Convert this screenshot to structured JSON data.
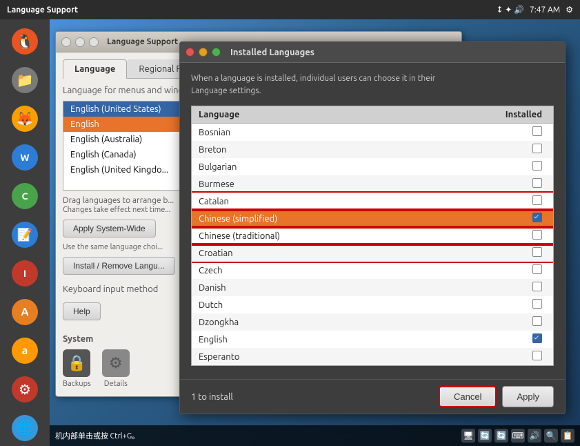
{
  "taskbar": {
    "title": "Language Support",
    "time": "7:47 AM",
    "icons": [
      "↕",
      "✦",
      "🔊"
    ]
  },
  "sidebar": {
    "items": [
      {
        "label": "Ubuntu",
        "color": "#e95420",
        "icon": "🐧"
      },
      {
        "label": "Files",
        "color": "#7a7a7a",
        "icon": "📁"
      },
      {
        "label": "Firefox",
        "color": "#f8a000",
        "icon": "🦊"
      },
      {
        "label": "Writer",
        "color": "#2d7dd6",
        "icon": "W"
      },
      {
        "label": "Calc",
        "color": "#48a34b",
        "icon": "C"
      },
      {
        "label": "Writer2",
        "color": "#2d7dd6",
        "icon": "📝"
      },
      {
        "label": "Impress",
        "color": "#c0392b",
        "icon": "I"
      },
      {
        "label": "Fonts",
        "color": "#e67e22",
        "icon": "A"
      },
      {
        "label": "Amazon",
        "color": "#ff9900",
        "icon": "a"
      },
      {
        "label": "Settings",
        "color": "#c0392b",
        "icon": "⚙"
      },
      {
        "label": "Network",
        "color": "#3498db",
        "icon": "🌐"
      }
    ]
  },
  "lang_support_window": {
    "title": "Language Support",
    "tabs": [
      "Language",
      "Regional Formats"
    ],
    "active_tab": "Language",
    "section_label": "Language for menus and windows:",
    "languages": [
      {
        "name": "English (United States)",
        "selected": true
      },
      {
        "name": "English",
        "selected": false
      },
      {
        "name": "English (Australia)",
        "selected": false
      },
      {
        "name": "English (Canada)",
        "selected": false
      },
      {
        "name": "English (United Kingdom)",
        "selected": false
      }
    ],
    "drag_note": "Drag languages to arrange b",
    "drag_note2": "Changes take effect next time",
    "apply_system_btn": "Apply System-Wide",
    "use_note": "Use the same language choi...",
    "install_btn": "Install / Remove Langu...",
    "keyboard_label": "Keyboard input method",
    "help_btn": "Help",
    "system_section": "System",
    "system_items": [
      {
        "label": "Backups",
        "icon": "🔒",
        "bg": "#555"
      },
      {
        "label": "Details",
        "icon": "⚙",
        "bg": "#888"
      }
    ]
  },
  "installed_dialog": {
    "title": "Installed Languages",
    "description": "When a language is installed, individual users can choose it in their\nLanguage settings.",
    "col_language": "Language",
    "col_installed": "Installed",
    "languages": [
      {
        "name": "Bosnian",
        "installed": false,
        "selected": false,
        "highlight": false
      },
      {
        "name": "Breton",
        "installed": false,
        "selected": false,
        "highlight": false
      },
      {
        "name": "Bulgarian",
        "installed": false,
        "selected": false,
        "highlight": false
      },
      {
        "name": "Burmese",
        "installed": false,
        "selected": false,
        "highlight": false
      },
      {
        "name": "Catalan",
        "installed": false,
        "selected": false,
        "highlight": true
      },
      {
        "name": "Chinese (simplified)",
        "installed": true,
        "selected": true,
        "highlight": true
      },
      {
        "name": "Chinese (traditional)",
        "installed": false,
        "selected": false,
        "highlight": true
      },
      {
        "name": "Croatian",
        "installed": false,
        "selected": false,
        "highlight": true
      },
      {
        "name": "Czech",
        "installed": false,
        "selected": false,
        "highlight": false
      },
      {
        "name": "Danish",
        "installed": false,
        "selected": false,
        "highlight": false
      },
      {
        "name": "Dutch",
        "installed": false,
        "selected": false,
        "highlight": false
      },
      {
        "name": "Dzongkha",
        "installed": false,
        "selected": false,
        "highlight": false
      },
      {
        "name": "English",
        "installed": true,
        "selected": false,
        "highlight": false
      },
      {
        "name": "Esperanto",
        "installed": false,
        "selected": false,
        "highlight": false
      }
    ],
    "footer_info": "1 to install",
    "cancel_btn": "Cancel",
    "apply_btn": "Apply"
  },
  "bottom_bar": {
    "text": "机内部单击或按 Ctrl+G。",
    "icons": [
      "🖥",
      "🔄",
      "🔄",
      "⌨",
      "🔊",
      "🔍",
      "📋"
    ]
  }
}
